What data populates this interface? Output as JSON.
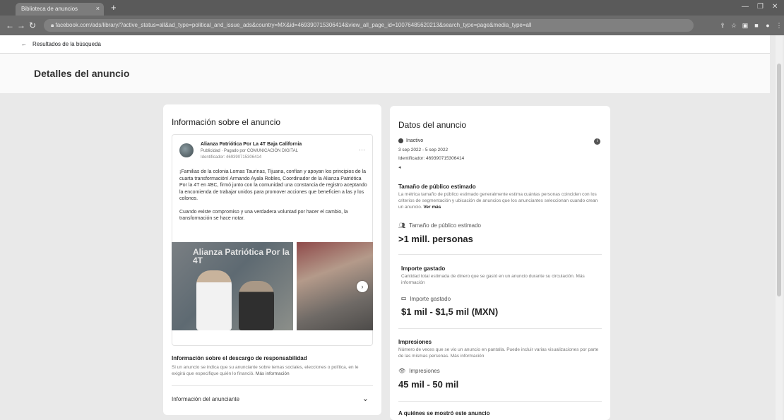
{
  "browser": {
    "tab_title": "Biblioteca de anuncios",
    "tab_close": "×",
    "new_tab": "+",
    "url": "facebook.com/ads/library/?active_status=all&ad_type=political_and_issue_ads&country=MX&id=469390715306414&view_all_page_id=10076485620213&search_type=page&media_type=all"
  },
  "nav": {
    "back_arrow": "←",
    "back_label": "Resultados de la búsqueda"
  },
  "page": {
    "title": "Detalles del anuncio"
  },
  "left_card": {
    "title": "Información sobre el anuncio",
    "preview": {
      "advertiser": "Alianza Patriótica Por La 4T Baja California",
      "sponsored": "Publicidad · Pagado por COMUNICACIÓN DIGITAL",
      "id_line": "Identificador: 469390715306414",
      "body_1": "¡Familias de la colonia Lomas Taurinas, Tijuana, confían y apoyan los principios de la cuarta transformación! Armando Ayala Robles, Coordinador de la Alianza Patriótica Por la 4T en #BC, firmó junto con la comunidad una constancia de registro aceptando la encomienda de trabajar unidos para promover acciones que beneficien a las y los colonos.",
      "body_2": "Cuando existe compromiso y una verdadera voluntad por hacer el cambio, la transformación se hace notar.",
      "banner": "Alianza Patriótica Por la 4T"
    },
    "disclaimer": {
      "title": "Información sobre el descargo de responsabilidad",
      "desc": "Si un anuncio se indica que su anunciante sobre temas sociales, elecciones o política, en le exigirá que especifique quién lo financió.",
      "more": "Más información"
    },
    "advertiser_row": "Información del anunciante"
  },
  "right_card": {
    "title": "Datos del anuncio",
    "status": "Inactivo",
    "dates": "3 sep 2022 - 5 sep 2022",
    "id": "Identificador: 469390715306414",
    "audience": {
      "title": "Tamaño de público estimado",
      "desc": "La métrica tamaño de público estimado generalmente estima cuántas personas coinciden con los criterios de segmentación y ubicación de anuncios que los anunciantes seleccionan cuando crean un anuncio.",
      "more": "Ver más",
      "label": "Tamaño de público estimado",
      "value": ">1 mill. personas"
    },
    "spend": {
      "title": "Importe gastado",
      "desc": "Cantidad total estimada de dinero que se gastó en un anuncio durante su circulación.",
      "more": "Más información",
      "label": "Importe gastado",
      "value": "$1 mil - $1,5 mil (MXN)"
    },
    "impressions": {
      "title": "Impresiones",
      "desc": "Número de veces que se vio un anuncio en pantalla. Puede incluir varias visualizaciones por parte de las mismas personas.",
      "more": "Más información",
      "label": "Impresiones",
      "value": "45 mil - 50 mil"
    },
    "shown_to": {
      "title": "A quiénes se mostró este anuncio"
    }
  }
}
